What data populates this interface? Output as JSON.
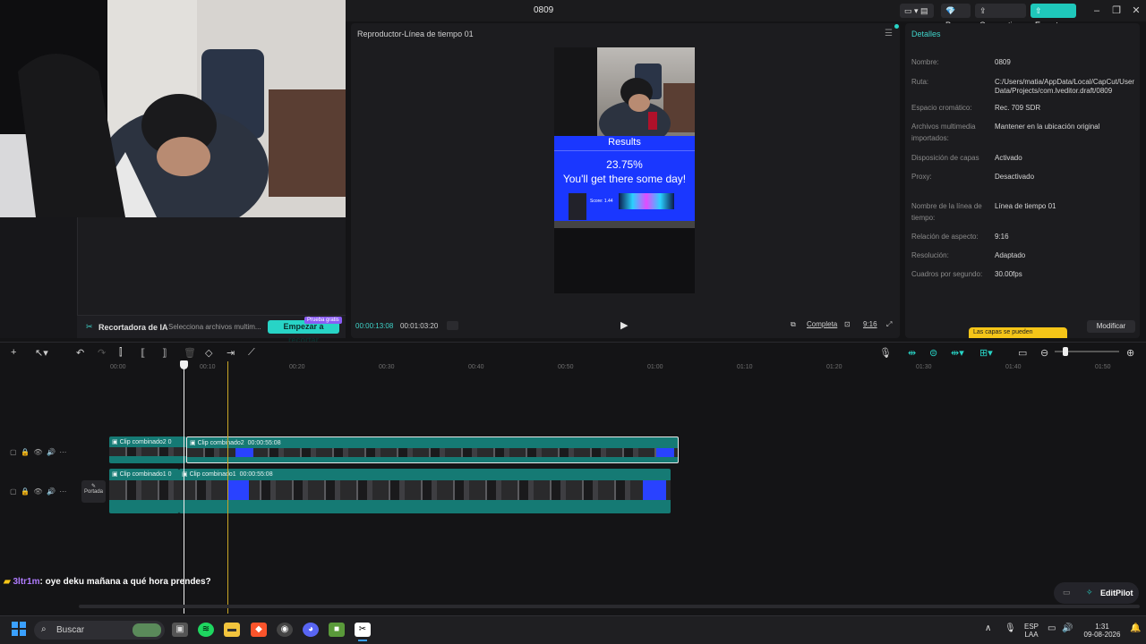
{
  "window": {
    "title": "0809",
    "pro_label": "Pro",
    "share_label": "Compartir",
    "export_label": "Exportar"
  },
  "left_panel": {
    "ai_cutter_label": "Recortadora de IA",
    "ai_hint": "Selecciona archivos multim...",
    "start_button": "Empezar a recortar",
    "trial_badge": "Prueba gratis"
  },
  "player": {
    "title": "Reproductor-Línea de tiempo 01",
    "current_time": "00:00:13:08",
    "total_time": "00:01:03:20",
    "complete_label": "Completa",
    "ratio_label": "9:16",
    "preview": {
      "results_title": "Results",
      "percent": "23.75%",
      "message": "You'll get there some day!",
      "score": "Score: 1.44"
    }
  },
  "details": {
    "title": "Detalles",
    "rows": [
      {
        "label": "Nombre:",
        "value": "0809"
      },
      {
        "label": "Ruta:",
        "value": "C:/Users/matia/AppData/Local/CapCut/User Data/Projects/com.lveditor.draft/0809"
      },
      {
        "label": "Espacio cromático:",
        "value": "Rec. 709 SDR"
      },
      {
        "label": "Archivos multimedia importados:",
        "value": "Mantener en la ubicación original"
      },
      {
        "label": "Disposición de capas",
        "value": "Activado"
      },
      {
        "label": "Proxy:",
        "value": "Desactivado"
      },
      {
        "label": "Nombre de la línea de tiempo:",
        "value": "Línea de tiempo 01"
      },
      {
        "label": "Relación de aspecto:",
        "value": "9:16"
      },
      {
        "label": "Resolución:",
        "value": "Adaptado"
      },
      {
        "label": "Cuadros por segundo:",
        "value": "30.00fps"
      }
    ],
    "modify_button": "Modificar",
    "tooltip": "Las capas se pueden"
  },
  "timeline": {
    "ticks": [
      "00:00",
      "00:10",
      "00:20",
      "00:30",
      "00:40",
      "00:50",
      "01:00",
      "01:10",
      "01:20",
      "01:30",
      "01:40",
      "01:50"
    ],
    "cover_label": "Portada",
    "clips": {
      "top_a": "Clip combinado2",
      "top_a_suffix": "0",
      "top_b": "Clip combinado2",
      "top_b_time": "00:00:55:08",
      "main_a": "Clip combinado1",
      "main_a_suffix": "0",
      "main_b": "Clip combinado1",
      "main_b_time": "00:00:55:08"
    }
  },
  "chat": {
    "user": "3ltr1m",
    "message": ": oye deku mañana a qué hora prendes?"
  },
  "editpilot_label": "EditPilot",
  "taskbar": {
    "search_placeholder": "Buscar",
    "lang_top": "ESP",
    "lang_bottom": "LAA",
    "time": "1:31",
    "date": "09-08-2026"
  },
  "colors": {
    "accent": "#28d4c6",
    "clip": "#157a74",
    "preview_blue": "#1a37ff",
    "chat_user": "#b07cff"
  }
}
